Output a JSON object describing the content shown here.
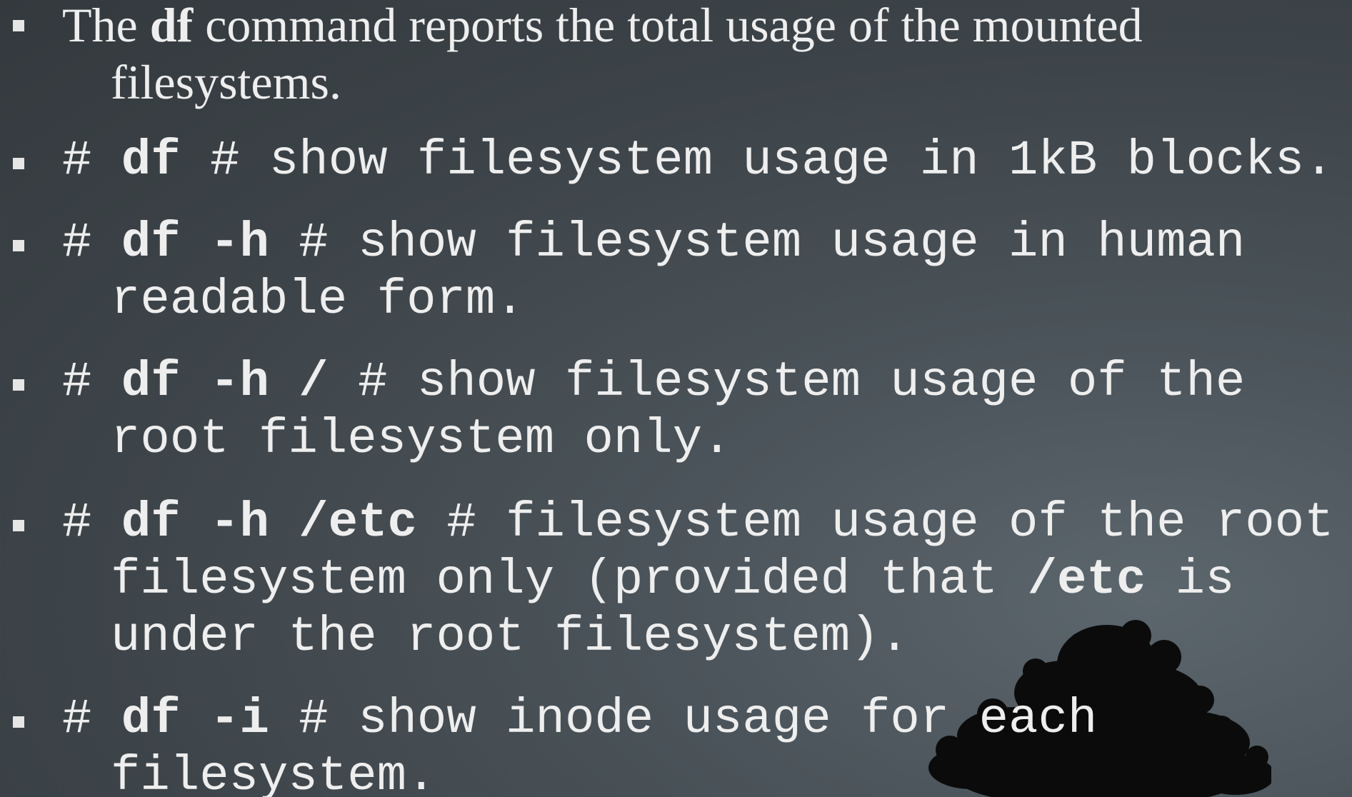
{
  "slide": {
    "bullets": [
      {
        "type": "serif",
        "line1_a": "The ",
        "line1_bold": "df",
        "line1_b": " command reports the total usage of the mounted",
        "line2": "filesystems."
      },
      {
        "type": "mono",
        "hash": "# ",
        "cmd": "df",
        "comment": " # show filesystem usage in 1kB blocks."
      },
      {
        "type": "mono",
        "hash": "# ",
        "cmd": "df -h",
        "comment": " # show filesystem usage in human",
        "line2": "readable form."
      },
      {
        "type": "mono",
        "hash": "# ",
        "cmd": "df -h /",
        "comment": " # show filesystem usage of the",
        "line2": "root filesystem only."
      },
      {
        "type": "mono",
        "hash": "# ",
        "cmd": "df -h /etc",
        "comment": " # filesystem usage of the root",
        "line2_a": "filesystem only (provided that ",
        "line2_bold": "/etc",
        "line2_b": " is",
        "line3": "under the root filesystem)."
      },
      {
        "type": "mono",
        "hash": "# ",
        "cmd": "df -i",
        "comment": " # show inode usage for each",
        "line2": "filesystem."
      }
    ]
  },
  "colors": {
    "background": "#3d4449",
    "text": "#eeeeee",
    "tree": "#0a0a0a"
  }
}
